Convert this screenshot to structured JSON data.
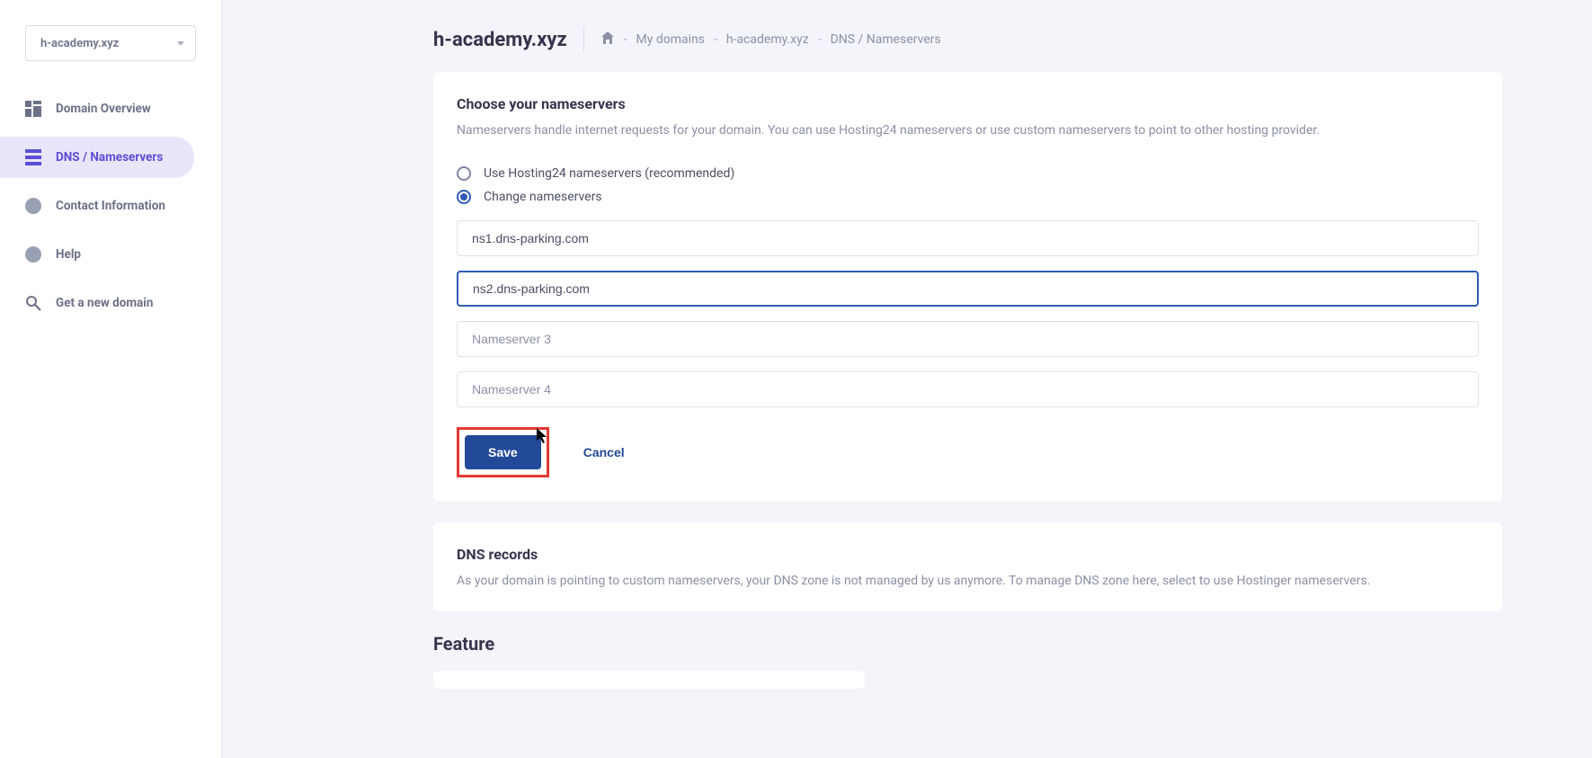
{
  "sidebar": {
    "domainSelect": "h-academy.xyz",
    "items": [
      {
        "label": "Domain Overview"
      },
      {
        "label": "DNS / Nameservers"
      },
      {
        "label": "Contact Information"
      },
      {
        "label": "Help"
      },
      {
        "label": "Get a new domain"
      }
    ]
  },
  "header": {
    "title": "h-academy.xyz",
    "breadcrumb": {
      "myDomains": "My domains",
      "domain": "h-academy.xyz",
      "current": "DNS / Nameservers"
    }
  },
  "nameservers": {
    "title": "Choose your nameservers",
    "description": "Nameservers handle internet requests for your domain. You can use Hosting24 nameservers or use custom nameservers to point to other hosting provider.",
    "options": {
      "recommended": "Use Hosting24 nameservers (recommended)",
      "change": "Change nameservers"
    },
    "inputs": {
      "ns1": "ns1.dns-parking.com",
      "ns2": "ns2.dns-parking.com",
      "ns3_placeholder": "Nameserver 3",
      "ns4_placeholder": "Nameserver 4"
    },
    "buttons": {
      "save": "Save",
      "cancel": "Cancel"
    }
  },
  "dnsRecords": {
    "title": "DNS records",
    "description": "As your domain is pointing to custom nameservers, your DNS zone is not managed by us anymore. To manage DNS zone here, select to use Hostinger nameservers."
  },
  "feature": {
    "title": "Feature"
  }
}
